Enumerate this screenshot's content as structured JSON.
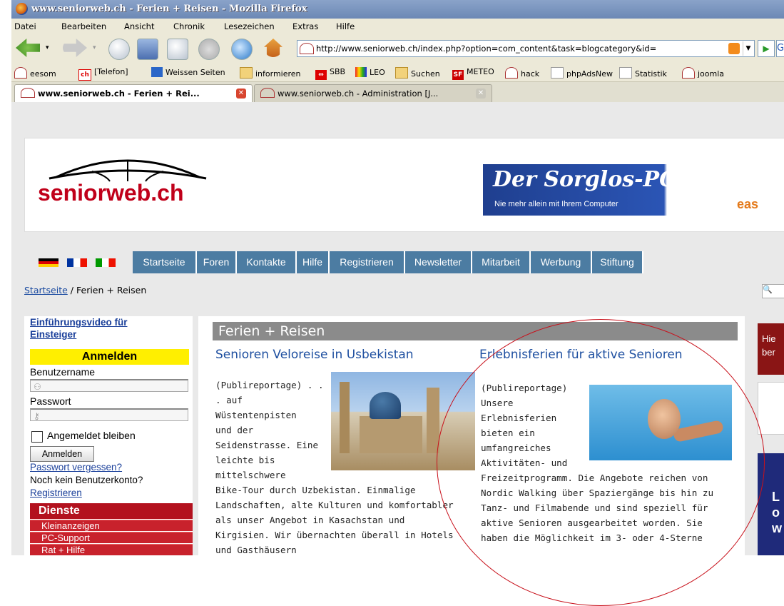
{
  "window": {
    "title": "www.seniorweb.ch - Ferien + Reisen - Mozilla Firefox"
  },
  "menubar": [
    "Datei",
    "Bearbeiten",
    "Ansicht",
    "Chronik",
    "Lesezeichen",
    "Extras",
    "Hilfe"
  ],
  "navbar": {
    "url": "http://www.seniorweb.ch/index.php?option=com_content&task=blogcategory&id=",
    "search_stub": "G"
  },
  "bookmarks": [
    {
      "label": "eesom",
      "icon": "seniorweb-icon"
    },
    {
      "label": "[Telefon]",
      "icon": "ch-icon"
    },
    {
      "label": "Weissen Seiten",
      "icon": "weisse-seiten-icon"
    },
    {
      "label": "informieren",
      "icon": "folder-icon"
    },
    {
      "label": "SBB",
      "icon": "sbb-icon"
    },
    {
      "label": "LEO",
      "icon": "leo-icon"
    },
    {
      "label": "Suchen",
      "icon": "folder-icon"
    },
    {
      "label": "METEO",
      "icon": "sf-icon"
    },
    {
      "label": "hack",
      "icon": "seniorweb-icon"
    },
    {
      "label": "phpAdsNew",
      "icon": "page-icon"
    },
    {
      "label": "Statistik",
      "icon": "page-icon"
    },
    {
      "label": "joomla",
      "icon": "seniorweb-icon"
    }
  ],
  "tabs": [
    {
      "label": "www.seniorweb.ch - Ferien + Rei..."
    },
    {
      "label": "www.seniorweb.ch - Administration [J..."
    }
  ],
  "site": {
    "logo_text": "seniorweb.ch",
    "banner": {
      "headline": "Der Sorglos-PC",
      "subline": "Nie mehr allein mit Ihrem Computer",
      "brand_partial": "eas"
    },
    "languages": [
      "de-flag",
      "fr-flag",
      "it-flag"
    ],
    "menu": [
      "Startseite",
      "Foren",
      "Kontakte",
      "Hilfe",
      "Registrieren",
      "Newsletter",
      "Mitarbeit",
      "Werbung",
      "Stiftung"
    ],
    "breadcrumb": {
      "home": "Startseite",
      "sep": "/",
      "current": "Ferien + Reisen"
    }
  },
  "sidebar": {
    "intro_link": "Einführungsvideo für Einsteiger",
    "login_title": "Anmelden",
    "username_label": "Benutzername",
    "password_label": "Passwort",
    "remember_label": "Angemeldet bleiben",
    "login_button": "Anmelden",
    "forgot_link": "Passwort vergessen?",
    "no_account": "Noch kein Benutzerkonto?",
    "register_link": "Registrieren",
    "services_title": "Dienste",
    "services": [
      "Kleinanzeigen",
      "PC-Support",
      "Rat + Hilfe"
    ]
  },
  "main": {
    "section_title": "Ferien + Reisen",
    "article1": {
      "title": "Senioren Veloreise in Usbekistan",
      "lines_short": [
        "(Publireportage) . .",
        ". auf",
        "Wüstentenpisten",
        "und der",
        "Seidenstrasse. Eine",
        "leichte bis",
        "mittelschwere"
      ],
      "lines_full": [
        "Bike-Tour durch Uzbekistan.  Einmalige",
        "Landschaften, alte Kulturen und komfortabler",
        "als unser Angebot in Kasachstan und",
        "Kirgisien. Wir übernachten überall in Hotels",
        "und Gasthäusern"
      ]
    },
    "article2": {
      "title": "Erlebnisferien für aktive Senioren",
      "lines_short": [
        "(Publireportage)",
        "Unsere",
        "Erlebnisferien",
        "bieten ein",
        "umfangreiches",
        "Aktivitäten- und"
      ],
      "lines_full": [
        "Freizeitprogramm. Die Angebote reichen von",
        "Nordic Walking über Spaziergänge bis hin zu",
        "Tanz- und Filmabende und sind speziell für",
        "aktive Senioren ausgearbeitet worden. Sie",
        "haben die Möglichkeit im 3- oder 4-Sterne"
      ]
    }
  },
  "right": {
    "box1": "Hie ber",
    "box3": "L o w"
  },
  "colors": {
    "menu_blue": "#4c7ca2",
    "logo_red": "#c0001a",
    "login_yellow": "#ffef00",
    "services_red": "#b3111e",
    "title_blue": "#1e4fa0",
    "annotation_red": "#c8121c"
  }
}
